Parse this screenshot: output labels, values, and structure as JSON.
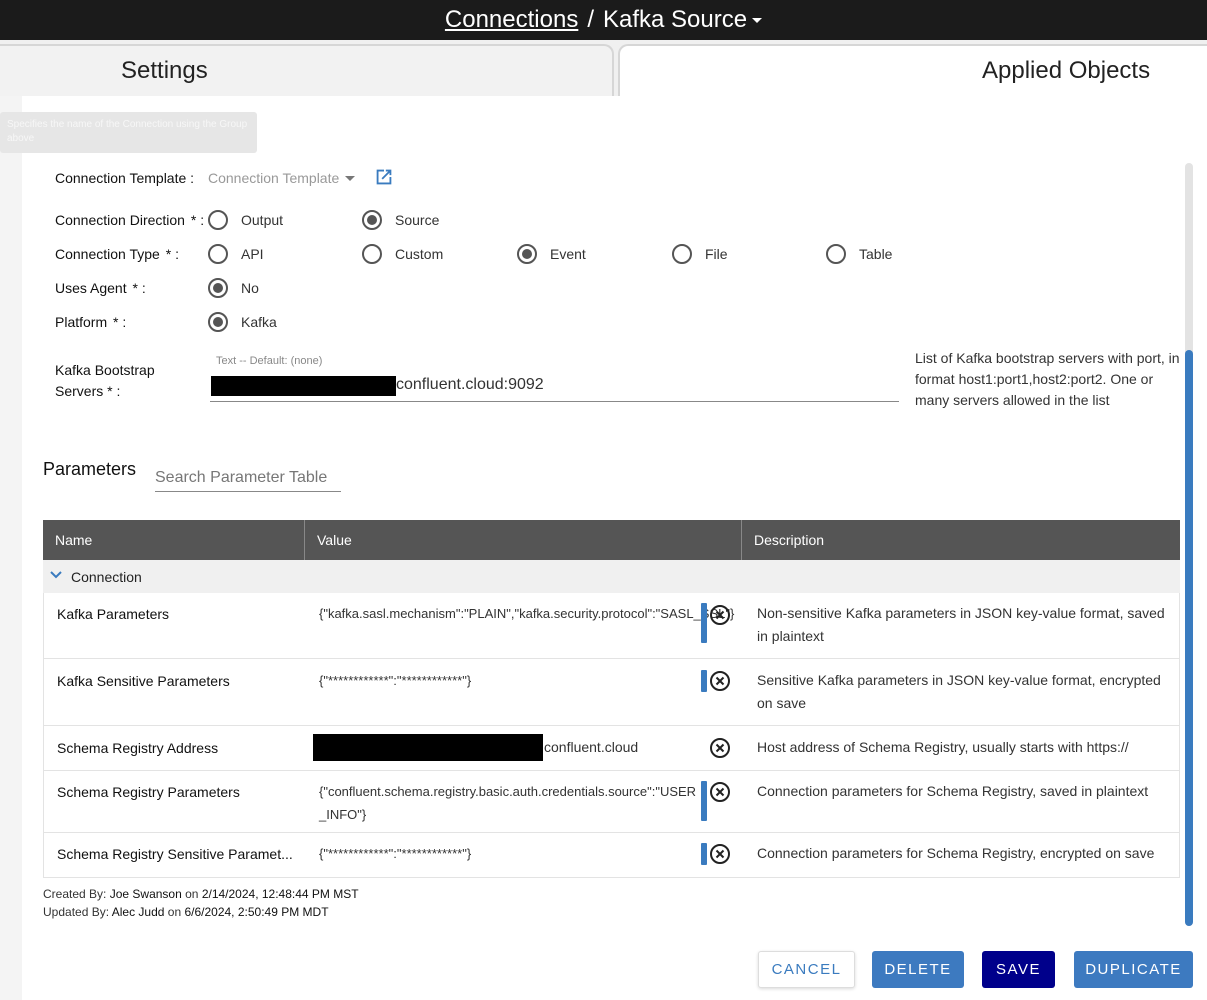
{
  "header": {
    "breadcrumb_link": "Connections",
    "separator": "/",
    "current": "Kafka Source"
  },
  "tabs": {
    "settings": "Settings",
    "applied_objects": "Applied Objects"
  },
  "tooltip": "Specifies the name of the Connection using the Group above",
  "form": {
    "template_label": "Connection Template :",
    "template_placeholder": "Connection Template",
    "direction_label": "Connection Direction",
    "direction_options": [
      "Output",
      "Source"
    ],
    "direction_selected": "Source",
    "type_label": "Connection Type",
    "type_options": [
      "API",
      "Custom",
      "Event",
      "File",
      "Table"
    ],
    "type_selected": "Event",
    "agent_label": "Uses Agent",
    "agent_options": [
      "No"
    ],
    "platform_label": "Platform",
    "platform_options": [
      "Kafka"
    ],
    "bootstrap_label_1": "Kafka Bootstrap",
    "bootstrap_label_2": "Servers",
    "bootstrap_hint": "Text -- Default: (none)",
    "bootstrap_value_suffix": "confluent.cloud:9092",
    "bootstrap_desc": "List of Kafka bootstrap servers with port, in format host1:port1,host2:port2. One or many servers allowed in the list",
    "required_mark": "*",
    "colon": ":"
  },
  "parameters": {
    "title": "Parameters",
    "search_placeholder": "Search Parameter Table",
    "columns": [
      "Name",
      "Value",
      "Description"
    ],
    "group": "Connection",
    "rows": [
      {
        "name": "Kafka Parameters",
        "value": "{\"kafka.sasl.mechanism\":\"PLAIN\",\"kafka.security.protocol\":\"SASL_SSL\"}",
        "description": "Non-sensitive Kafka parameters in JSON key-value format, saved in plaintext"
      },
      {
        "name": "Kafka Sensitive Parameters",
        "value": "{\"************\":\"************\"}",
        "description": "Sensitive Kafka parameters in JSON key-value format, encrypted on save"
      },
      {
        "name": "Schema Registry Address",
        "value": "confluent.cloud",
        "description": "Host address of Schema Registry, usually starts with https://"
      },
      {
        "name": "Schema Registry Parameters",
        "value": "{\"confluent.schema.registry.basic.auth.credentials.source\":\"USER_INFO\"}",
        "description": "Connection parameters for Schema Registry, saved in plaintext"
      },
      {
        "name": "Schema Registry Sensitive Paramet...",
        "value": "{\"************\":\"************\"}",
        "description": "Connection parameters for Schema Registry, encrypted on save"
      }
    ]
  },
  "audit": {
    "created_prefix": "Created By:",
    "created_by": "Joe Swanson",
    "created_on_word": "on",
    "created_at": "2/14/2024, 12:48:44 PM MST",
    "updated_prefix": "Updated By:",
    "updated_by": "Alec Judd",
    "updated_on_word": "on",
    "updated_at": "6/6/2024, 2:50:49 PM MDT"
  },
  "actions": {
    "cancel": "CANCEL",
    "delete": "DELETE",
    "save": "SAVE",
    "duplicate": "DUPLICATE"
  },
  "colors": {
    "accent": "#3d7ac0",
    "save": "#00008b",
    "header_bg": "#1b1b1b",
    "table_header_bg": "#555555"
  },
  "icons": {
    "external": "external-link-icon",
    "clear": "clear-circle-x-icon",
    "expand": "chevron-down-icon",
    "dropdown": "caret-down-icon"
  }
}
